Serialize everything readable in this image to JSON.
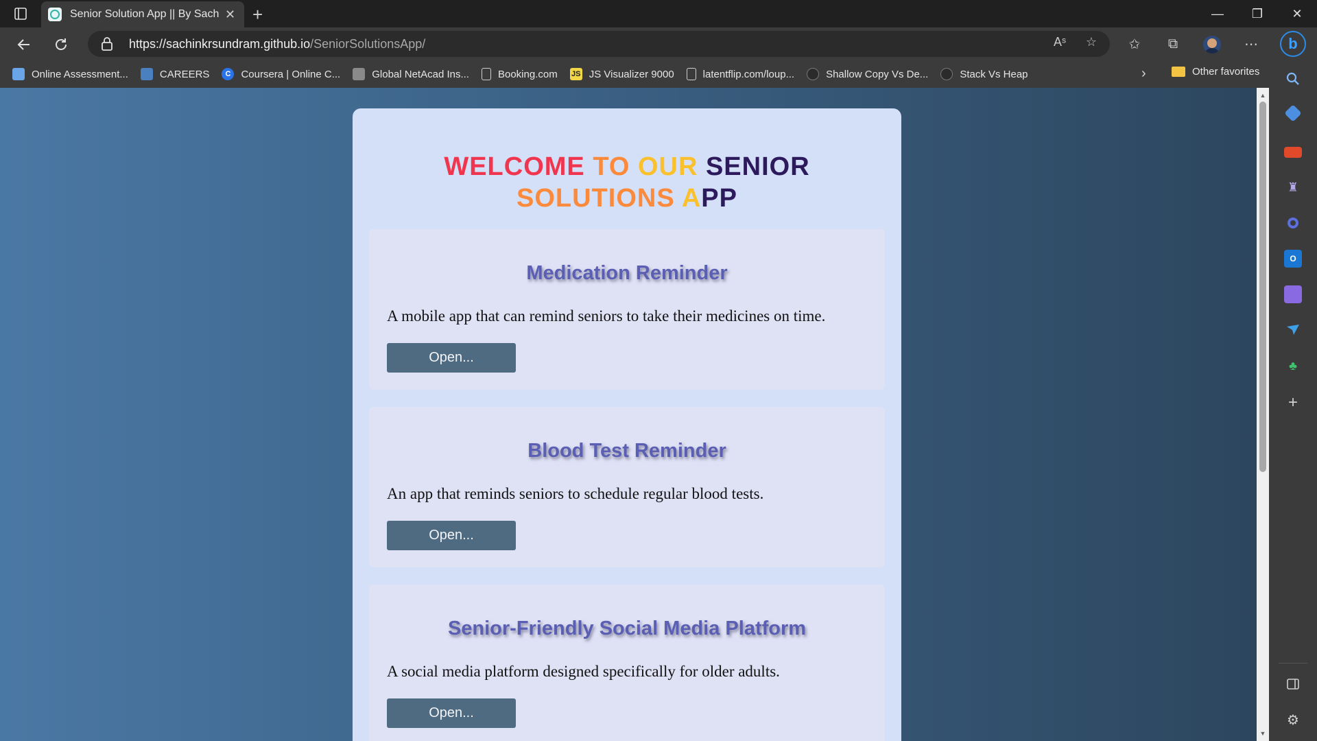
{
  "browser": {
    "tab_title": "Senior Solution App || By SachinKrSundram",
    "tab_close": "✕",
    "new_tab": "+",
    "url_host": "https://sachinkrsundram.github.io",
    "url_path": "/SeniorSolutionsApp/",
    "window_minimize": "—",
    "window_restore": "❐",
    "window_close": "✕"
  },
  "favorites": {
    "items": [
      {
        "label": "Online Assessment...",
        "icon": "globe-icon",
        "icon_text": "",
        "icon_color": "#6aa5e8"
      },
      {
        "label": "CAREERS",
        "icon": "careers-icon",
        "icon_text": "",
        "icon_color": "#4a7fc0"
      },
      {
        "label": "Coursera | Online C...",
        "icon": "coursera-icon",
        "icon_text": "C",
        "icon_color": "#2a73e8"
      },
      {
        "label": "Global NetAcad Ins...",
        "icon": "netacad-icon",
        "icon_text": "",
        "icon_color": "#8a8a8a"
      },
      {
        "label": "Booking.com",
        "icon": "page-icon",
        "icon_text": "",
        "icon_color": "#cfcfcf"
      },
      {
        "label": "JS Visualizer 9000",
        "icon": "js-icon",
        "icon_text": "JS",
        "icon_color": "#f1d745"
      },
      {
        "label": "latentflip.com/loup...",
        "icon": "page-icon",
        "icon_text": "",
        "icon_color": "#cfcfcf"
      },
      {
        "label": "Shallow Copy Vs De...",
        "icon": "github-icon",
        "icon_text": "",
        "icon_color": "#2b2b2b"
      },
      {
        "label": "Stack Vs Heap",
        "icon": "github-icon",
        "icon_text": "",
        "icon_color": "#2b2b2b"
      }
    ],
    "more": "›",
    "other": "Other favorites"
  },
  "page": {
    "welcome_parts": [
      "WELCOME ",
      "TO ",
      "OUR ",
      "SENIOR",
      "SOLUTIONS ",
      "A",
      "PP"
    ],
    "cards": [
      {
        "title": "Medication Reminder",
        "description": "A mobile app that can remind seniors to take their medicines on time.",
        "button": "Open..."
      },
      {
        "title": "Blood Test Reminder",
        "description": "An app that reminds seniors to schedule regular blood tests.",
        "button": "Open..."
      },
      {
        "title": "Senior-Friendly Social Media Platform",
        "description": "A social media platform designed specifically for older adults.",
        "button": "Open..."
      }
    ]
  },
  "colors": {
    "accent_red": "#f0364e",
    "accent_orange": "#fb8a3c",
    "accent_yellow": "#fbc02d",
    "accent_navy": "#2c1a5c",
    "card_title": "#5b5fb3",
    "button": "#4f6b82"
  }
}
